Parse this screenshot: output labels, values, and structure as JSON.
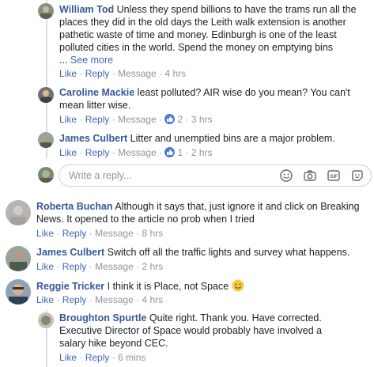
{
  "comments": [
    {
      "author": "William Tod",
      "text": "Unless they spend billions to have the trams run all the places they did in the old days the Leith walk extension is another pathetic waste of time and money. Edinburgh is one of the least polluted cities in the world. Spend the money on emptying bins",
      "ellipsis": "...",
      "see_more": "See more",
      "like": "Like",
      "reply": "Reply",
      "message": "Message",
      "time": "4 hrs"
    },
    {
      "author": "Caroline Mackie",
      "text": "least polluted? AIR wise do you mean? You can't mean litter wise.",
      "like": "Like",
      "reply": "Reply",
      "message": "Message",
      "reactions": "2",
      "time": "3 hrs"
    },
    {
      "author": "James Culbert",
      "text": "Litter and unemptied bins are a major problem.",
      "like": "Like",
      "reply": "Reply",
      "message": "Message",
      "reactions": "1",
      "time": "2 hrs"
    },
    {
      "author": "Roberta Buchan",
      "text": "Although it says that, just ignore it and click on Breaking News. It opened to the article no prob when I tried",
      "like": "Like",
      "reply": "Reply",
      "message": "Message",
      "time": "8 hrs"
    },
    {
      "author": "James Culbert",
      "text": "Switch off all the traffic lights and survey what happens.",
      "like": "Like",
      "reply": "Reply",
      "message": "Message",
      "time": "2 hrs"
    },
    {
      "author": "Reggie Tricker",
      "text": "I think it is Place, not Space",
      "emoji": "smiley-emoji",
      "like": "Like",
      "reply": "Reply",
      "message": "Message",
      "time": "4 hrs"
    },
    {
      "author": "Broughton Spurtle",
      "text": "Quite right. Thank you. Have corrected. Executive Director of Space would probably have involved a salary hike beyond CEC.",
      "like": "Like",
      "reply": "Reply",
      "time": "6 mins"
    }
  ],
  "reply_box": {
    "placeholder": "Write a reply...",
    "icons": [
      "emoji-icon",
      "camera-icon",
      "gif-icon",
      "sticker-icon"
    ]
  },
  "separator": "·",
  "colors": {
    "link": "#4267b2",
    "name": "#385898",
    "meta": "#90949c",
    "like_badge": "#4a7bd4"
  }
}
